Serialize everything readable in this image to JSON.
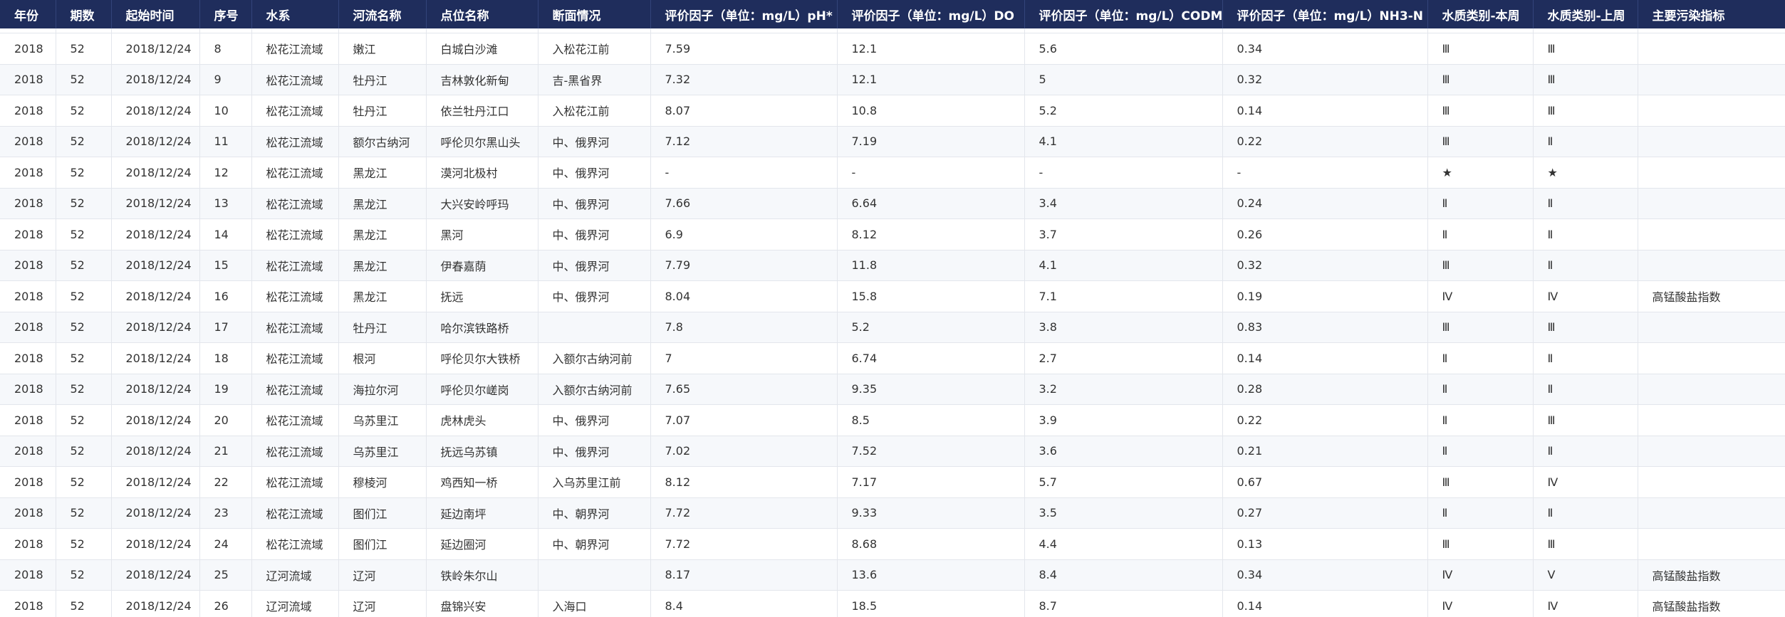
{
  "table": {
    "headers": [
      "年份",
      "期数",
      "起始时间",
      "序号",
      "水系",
      "河流名称",
      "点位名称",
      "断面情况",
      "评价因子（单位：mg/L）pH*",
      "评价因子（单位：mg/L）DO",
      "评价因子（单位：mg/L）CODMn",
      "评价因子（单位：mg/L）NH3-N",
      "水质类别-本周",
      "水质类别-上周",
      "主要污染指标"
    ],
    "rows": [
      [
        "2018",
        "52",
        "2018/12/24",
        "8",
        "松花江流域",
        "嫩江",
        "白城白沙滩",
        "入松花江前",
        "7.59",
        "12.1",
        "5.6",
        "0.34",
        "Ⅲ",
        "Ⅲ",
        ""
      ],
      [
        "2018",
        "52",
        "2018/12/24",
        "9",
        "松花江流域",
        "牡丹江",
        "吉林敦化新甸",
        "吉-黑省界",
        "7.32",
        "12.1",
        "5",
        "0.32",
        "Ⅲ",
        "Ⅲ",
        ""
      ],
      [
        "2018",
        "52",
        "2018/12/24",
        "10",
        "松花江流域",
        "牡丹江",
        "依兰牡丹江口",
        "入松花江前",
        "8.07",
        "10.8",
        "5.2",
        "0.14",
        "Ⅲ",
        "Ⅲ",
        ""
      ],
      [
        "2018",
        "52",
        "2018/12/24",
        "11",
        "松花江流域",
        "额尔古纳河",
        "呼伦贝尔黑山头",
        "中、俄界河",
        "7.12",
        "7.19",
        "4.1",
        "0.22",
        "Ⅲ",
        "Ⅱ",
        ""
      ],
      [
        "2018",
        "52",
        "2018/12/24",
        "12",
        "松花江流域",
        "黑龙江",
        "漠河北极村",
        "中、俄界河",
        "-",
        "-",
        "-",
        "-",
        "★",
        "★",
        ""
      ],
      [
        "2018",
        "52",
        "2018/12/24",
        "13",
        "松花江流域",
        "黑龙江",
        "大兴安岭呼玛",
        "中、俄界河",
        "7.66",
        "6.64",
        "3.4",
        "0.24",
        "Ⅱ",
        "Ⅱ",
        ""
      ],
      [
        "2018",
        "52",
        "2018/12/24",
        "14",
        "松花江流域",
        "黑龙江",
        "黑河",
        "中、俄界河",
        "6.9",
        "8.12",
        "3.7",
        "0.26",
        "Ⅱ",
        "Ⅱ",
        ""
      ],
      [
        "2018",
        "52",
        "2018/12/24",
        "15",
        "松花江流域",
        "黑龙江",
        "伊春嘉荫",
        "中、俄界河",
        "7.79",
        "11.8",
        "4.1",
        "0.32",
        "Ⅲ",
        "Ⅱ",
        ""
      ],
      [
        "2018",
        "52",
        "2018/12/24",
        "16",
        "松花江流域",
        "黑龙江",
        "抚远",
        "中、俄界河",
        "8.04",
        "15.8",
        "7.1",
        "0.19",
        "Ⅳ",
        "Ⅳ",
        "高锰酸盐指数"
      ],
      [
        "2018",
        "52",
        "2018/12/24",
        "17",
        "松花江流域",
        "牡丹江",
        "哈尔滨铁路桥",
        "",
        "7.8",
        "5.2",
        "3.8",
        "0.83",
        "Ⅲ",
        "Ⅲ",
        ""
      ],
      [
        "2018",
        "52",
        "2018/12/24",
        "18",
        "松花江流域",
        "根河",
        "呼伦贝尔大铁桥",
        "入额尔古纳河前",
        "7",
        "6.74",
        "2.7",
        "0.14",
        "Ⅱ",
        "Ⅱ",
        ""
      ],
      [
        "2018",
        "52",
        "2018/12/24",
        "19",
        "松花江流域",
        "海拉尔河",
        "呼伦贝尔嵯岗",
        "入额尔古纳河前",
        "7.65",
        "9.35",
        "3.2",
        "0.28",
        "Ⅱ",
        "Ⅱ",
        ""
      ],
      [
        "2018",
        "52",
        "2018/12/24",
        "20",
        "松花江流域",
        "乌苏里江",
        "虎林虎头",
        "中、俄界河",
        "7.07",
        "8.5",
        "3.9",
        "0.22",
        "Ⅱ",
        "Ⅲ",
        ""
      ],
      [
        "2018",
        "52",
        "2018/12/24",
        "21",
        "松花江流域",
        "乌苏里江",
        "抚远乌苏镇",
        "中、俄界河",
        "7.02",
        "7.52",
        "3.6",
        "0.21",
        "Ⅱ",
        "Ⅱ",
        ""
      ],
      [
        "2018",
        "52",
        "2018/12/24",
        "22",
        "松花江流域",
        "穆棱河",
        "鸡西知一桥",
        "入乌苏里江前",
        "8.12",
        "7.17",
        "5.7",
        "0.67",
        "Ⅲ",
        "Ⅳ",
        ""
      ],
      [
        "2018",
        "52",
        "2018/12/24",
        "23",
        "松花江流域",
        "图们江",
        "延边南坪",
        "中、朝界河",
        "7.72",
        "9.33",
        "3.5",
        "0.27",
        "Ⅱ",
        "Ⅱ",
        ""
      ],
      [
        "2018",
        "52",
        "2018/12/24",
        "24",
        "松花江流域",
        "图们江",
        "延边圈河",
        "中、朝界河",
        "7.72",
        "8.68",
        "4.4",
        "0.13",
        "Ⅲ",
        "Ⅲ",
        ""
      ],
      [
        "2018",
        "52",
        "2018/12/24",
        "25",
        "辽河流域",
        "辽河",
        "铁岭朱尔山",
        "",
        "8.17",
        "13.6",
        "8.4",
        "0.34",
        "Ⅳ",
        "Ⅴ",
        "高锰酸盐指数"
      ],
      [
        "2018",
        "52",
        "2018/12/24",
        "26",
        "辽河流域",
        "辽河",
        "盘锦兴安",
        "入海口",
        "8.4",
        "18.5",
        "8.7",
        "0.14",
        "Ⅳ",
        "Ⅳ",
        "高锰酸盐指数"
      ]
    ]
  }
}
